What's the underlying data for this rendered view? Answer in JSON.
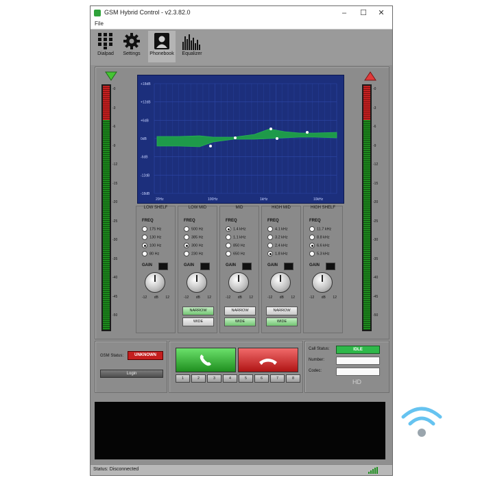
{
  "window": {
    "title": "GSM Hybrid Control - v2.3.82.0",
    "minimize": "–",
    "maximize": "☐",
    "close": "✕"
  },
  "menu": {
    "file": "File"
  },
  "toolbar": [
    {
      "label": "Dialpad",
      "icon": "dialpad-icon"
    },
    {
      "label": "Settings",
      "icon": "gear-icon"
    },
    {
      "label": "Phonebook",
      "icon": "phonebook-icon"
    },
    {
      "label": "Equalizer",
      "icon": "equalizer-icon"
    }
  ],
  "meter_scale": [
    "-0",
    "-3",
    "-6",
    "-9",
    "-12",
    "-15",
    "-20",
    "-25",
    "-30",
    "-35",
    "-40",
    "-45",
    "-50"
  ],
  "eq": {
    "y_labels": [
      "+18dB",
      "+12dB",
      "+6dB",
      "0dB",
      "-6dB",
      "-12dB",
      "-18dB"
    ],
    "x_labels": [
      "20Hz",
      "100Hz",
      "1kHz",
      "10kHz"
    ],
    "curve_color": "#1e9a4a",
    "bg_color": "#1c2f7c",
    "bands": [
      {
        "title": "LOW SHELF",
        "freq_label": "FREQ",
        "options": [
          "175 Hz",
          "130 Hz",
          "100 Hz",
          "80 Hz"
        ],
        "selected": 2,
        "gain_label": "GAIN",
        "scale": [
          "-12",
          "dB",
          "12"
        ],
        "narrow": "",
        "wide": ""
      },
      {
        "title": "LOW MID",
        "freq_label": "FREQ",
        "options": [
          "500 Hz",
          "385 Hz",
          "300 Hz",
          "230 Hz"
        ],
        "selected": 2,
        "gain_label": "GAIN",
        "scale": [
          "-12",
          "dB",
          "12"
        ],
        "narrow": "NARROW",
        "wide": "WIDE",
        "bw_selected": "narrow"
      },
      {
        "title": "MID",
        "freq_label": "FREQ",
        "options": [
          "1.4 kHz",
          "1.1 kHz",
          "850 Hz",
          "650 Hz"
        ],
        "selected": 0,
        "gain_label": "GAIN",
        "scale": [
          "-12",
          "dB",
          "12"
        ],
        "narrow": "NARROW",
        "wide": "WIDE",
        "bw_selected": "wide"
      },
      {
        "title": "HIGH MID",
        "freq_label": "FREQ",
        "options": [
          "4.1 kHz",
          "3.2 kHz",
          "2.4 kHz",
          "1.8 kHz"
        ],
        "selected": 3,
        "gain_label": "GAIN",
        "scale": [
          "-12",
          "dB",
          "12"
        ],
        "narrow": "NARROW",
        "wide": "WIDE",
        "bw_selected": "wide"
      },
      {
        "title": "HIGH SHELF",
        "freq_label": "FREQ",
        "options": [
          "11.7 kHz",
          "8.8 kHz",
          "6.6 kHz",
          "5.3 kHz"
        ],
        "selected": 2,
        "gain_label": "GAIN",
        "scale": [
          "-12",
          "dB",
          "12"
        ],
        "narrow": "",
        "wide": ""
      }
    ]
  },
  "gsm": {
    "status_label": "GSM Status:",
    "status_value": "UNKNOWN",
    "status_color": "#c41e1e",
    "login": "Login"
  },
  "call": {
    "answer_icon": "phone-answer-icon",
    "hangup_icon": "phone-hangup-icon",
    "digits": [
      "1",
      "2",
      "3",
      "4",
      "5",
      "6",
      "7",
      "8"
    ]
  },
  "callinfo": {
    "status_label": "Call Status:",
    "status_value": "IDLE",
    "status_color": "#2fb84a",
    "number_label": "Number:",
    "codec_label": "Codec:",
    "hd_label": "HD"
  },
  "statusbar": {
    "text": "Status: Disconnected"
  },
  "wifi_icon": "wifi-icon"
}
